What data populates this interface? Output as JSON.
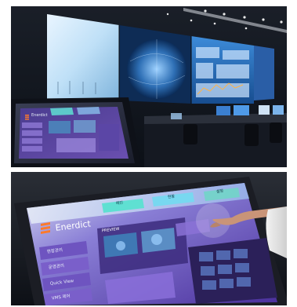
{
  "top_photo": {
    "inset_brand": "Enerdict"
  },
  "bottom_photo": {
    "brand": "Enerdict",
    "tabs": [
      "메인",
      "현황",
      "설정"
    ],
    "section_title": "PREVIEW",
    "menu": [
      "현장관리",
      "운영관리",
      "Quick View",
      "VMS 제어"
    ]
  },
  "colors": {
    "wall_glow": "#9fd6ff",
    "teal_tab": "#5fe0d2",
    "purple_ui": "#7b5cc4",
    "brand_orange": "#ff7a2a"
  }
}
